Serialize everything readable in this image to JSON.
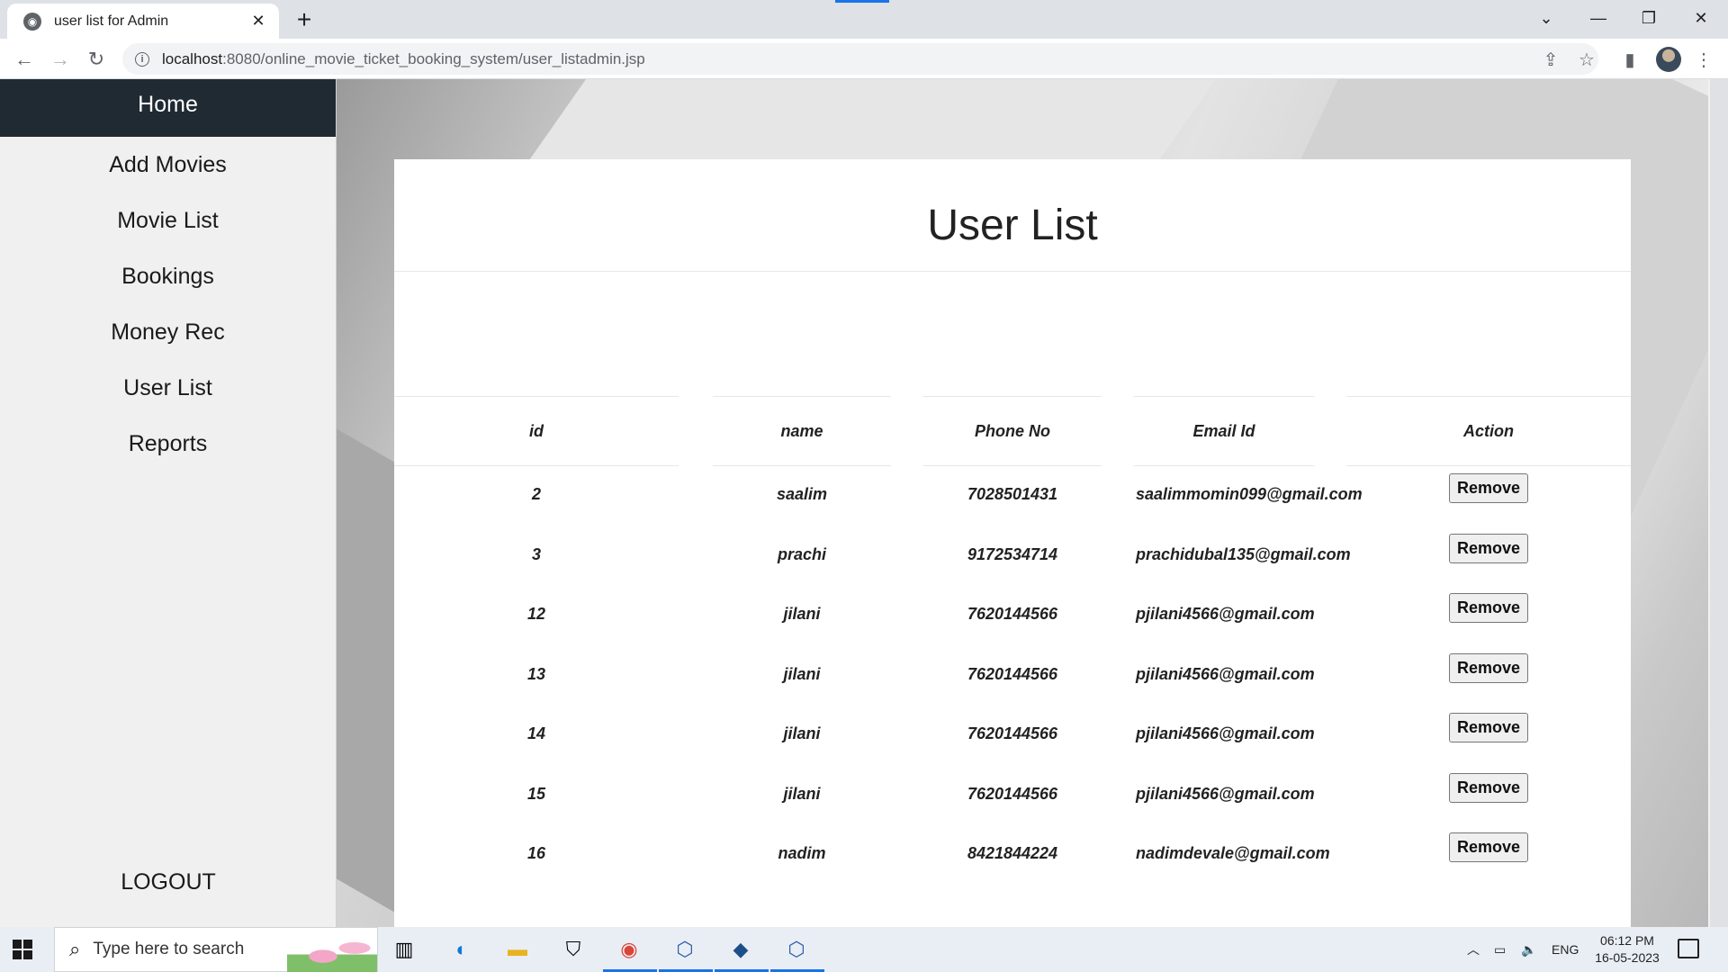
{
  "browser": {
    "tab_title": "user list for Admin",
    "url_host": "localhost",
    "url_path": ":8080/online_movie_ticket_booking_system/user_listadmin.jsp"
  },
  "sidebar": {
    "items": [
      {
        "label": "Home"
      },
      {
        "label": "Add Movies"
      },
      {
        "label": "Movie List"
      },
      {
        "label": "Bookings"
      },
      {
        "label": "Money Rec"
      },
      {
        "label": "User List"
      },
      {
        "label": "Reports"
      }
    ],
    "logout_label": "LOGOUT"
  },
  "main": {
    "title": "User List",
    "columns": [
      "id",
      "name",
      "Phone No",
      "Email Id",
      "Action"
    ],
    "rows": [
      {
        "id": "2",
        "name": "saalim",
        "phone": "7028501431",
        "email": "saalimmomin099@gmail.com",
        "action": "Remove"
      },
      {
        "id": "3",
        "name": "prachi",
        "phone": "9172534714",
        "email": "prachidubal135@gmail.com",
        "action": "Remove"
      },
      {
        "id": "12",
        "name": "jilani",
        "phone": "7620144566",
        "email": "pjilani4566@gmail.com",
        "action": "Remove"
      },
      {
        "id": "13",
        "name": "jilani",
        "phone": "7620144566",
        "email": "pjilani4566@gmail.com",
        "action": "Remove"
      },
      {
        "id": "14",
        "name": "jilani",
        "phone": "7620144566",
        "email": "pjilani4566@gmail.com",
        "action": "Remove"
      },
      {
        "id": "15",
        "name": "jilani",
        "phone": "7620144566",
        "email": "pjilani4566@gmail.com",
        "action": "Remove"
      },
      {
        "id": "16",
        "name": "nadim",
        "phone": "8421844224",
        "email": "nadimdevale@gmail.com",
        "action": "Remove"
      }
    ]
  },
  "taskbar": {
    "search_placeholder": "Type here to search",
    "language": "ENG",
    "time": "06:12 PM",
    "date": "16-05-2023"
  },
  "colors": {
    "sidebar_active_bg": "#1f2a33",
    "sidebar_bg": "#f0f0f0",
    "accent": "#1a73e8"
  }
}
